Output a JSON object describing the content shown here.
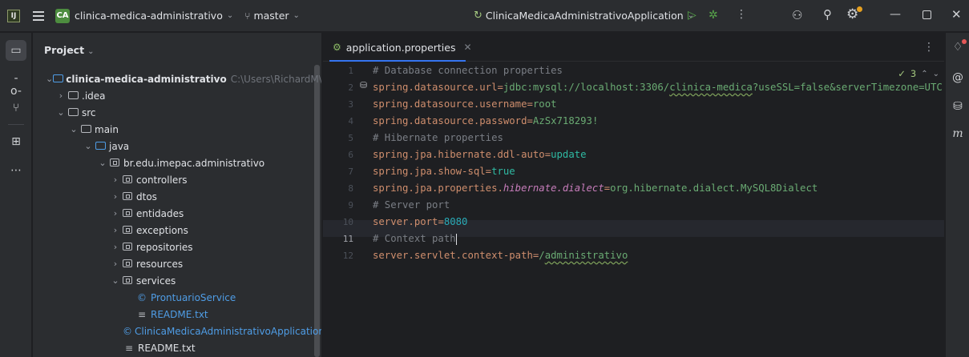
{
  "titlebar": {
    "logo": "IJ",
    "project_badge": "CA",
    "project_name": "clinica-medica-administrativo",
    "branch": "master",
    "run_config": "ClinicaMedicaAdministrativoApplication",
    "icons": [
      "hamburger-icon",
      "branch-icon",
      "run-icon",
      "debug-icon",
      "more-icon",
      "user-icon",
      "search-icon",
      "gear-icon",
      "minimize-icon",
      "restore-icon",
      "close-icon"
    ]
  },
  "left_strip": {
    "icons": [
      "project-folder-icon",
      "commit-icon",
      "git-branch-icon",
      "structure-icon",
      "more-tools-icon"
    ]
  },
  "project_panel": {
    "title": "Project",
    "tree": [
      {
        "label": "clinica-medica-administrativo",
        "path": "C:\\Users\\RichardM\\OneDr",
        "icon": "module-folder-icon"
      },
      {
        "label": ".idea",
        "icon": "folder-icon"
      },
      {
        "label": "src",
        "icon": "folder-icon"
      },
      {
        "label": "main",
        "icon": "folder-icon"
      },
      {
        "label": "java",
        "icon": "source-folder-icon"
      },
      {
        "label": "br.edu.imepac.administrativo",
        "icon": "package-icon"
      },
      {
        "label": "controllers",
        "icon": "package-icon"
      },
      {
        "label": "dtos",
        "icon": "package-icon"
      },
      {
        "label": "entidades",
        "icon": "package-icon"
      },
      {
        "label": "exceptions",
        "icon": "package-icon"
      },
      {
        "label": "repositories",
        "icon": "package-icon"
      },
      {
        "label": "resources",
        "icon": "package-icon"
      },
      {
        "label": "services",
        "icon": "package-icon"
      },
      {
        "label": "ProntuarioService",
        "icon": "class-icon"
      },
      {
        "label": "README.txt",
        "icon": "text-file-icon"
      },
      {
        "label": "ClinicaMedicaAdministrativoApplication",
        "icon": "spring-class-icon"
      },
      {
        "label": "README.txt",
        "icon": "text-file-icon"
      }
    ]
  },
  "editor": {
    "tab": "application.properties",
    "inspection_count": "3",
    "current_line": 11,
    "line_numbers": [
      "1",
      "2",
      "3",
      "4",
      "5",
      "6",
      "7",
      "8",
      "9",
      "10",
      "11",
      "12"
    ],
    "lines": [
      {
        "comment": "# Database connection properties"
      },
      {
        "key": "spring.datasource.url",
        "value_pre": "jdbc:mysql://localhost:3306/",
        "value_squig": "clinica-medica",
        "value_post": "?useSSL=false&serverTimezone=UTC"
      },
      {
        "key": "spring.datasource.username",
        "value": "root"
      },
      {
        "key": "spring.datasource.password",
        "value": "AzSx718293!"
      },
      {
        "comment": "# Hibernate properties"
      },
      {
        "key": "spring.jpa.hibernate.ddl-auto",
        "value": "update"
      },
      {
        "key": "spring.jpa.show-sql",
        "value": "true"
      },
      {
        "key_pre": "spring.jpa.properties.",
        "key_ital": "hibernate.dialect",
        "value": "org.hibernate.dialect.MySQL8Dialect"
      },
      {
        "comment": "# Server port"
      },
      {
        "key": "server.port",
        "value": "8080"
      },
      {
        "comment": "# Context path"
      },
      {
        "key": "server.servlet.context-path",
        "value_pre": "/",
        "value_squig": "administrativo"
      }
    ]
  },
  "right_strip": {
    "icons": [
      "notifications-icon",
      "ai-assistant-icon",
      "database-icon",
      "maven-icon"
    ],
    "maven_glyph": "m"
  }
}
